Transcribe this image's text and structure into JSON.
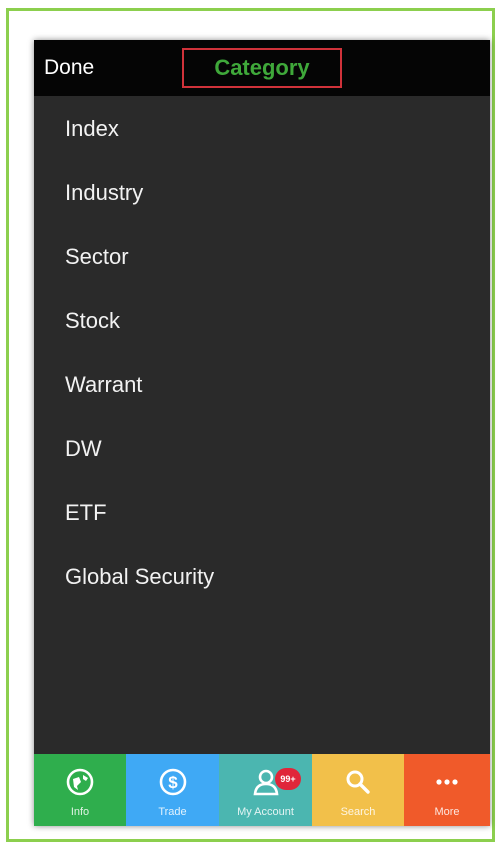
{
  "navbar": {
    "done_label": "Done",
    "title": "Category"
  },
  "categories": [
    "Index",
    "Industry",
    "Sector",
    "Stock",
    "Warrant",
    "DW",
    "ETF",
    "Global Security"
  ],
  "tabbar": {
    "tabs": [
      {
        "label": "Info",
        "icon": "globe-icon",
        "color": "#2fae4d"
      },
      {
        "label": "Trade",
        "icon": "dollar-icon",
        "color": "#3fa9f5"
      },
      {
        "label": "My Account",
        "icon": "person-icon",
        "color": "#4bb6b0",
        "badge": "99+"
      },
      {
        "label": "Search",
        "icon": "search-icon",
        "color": "#f2c04a"
      },
      {
        "label": "More",
        "icon": "more-dots-icon",
        "color": "#f05a2a"
      }
    ]
  }
}
